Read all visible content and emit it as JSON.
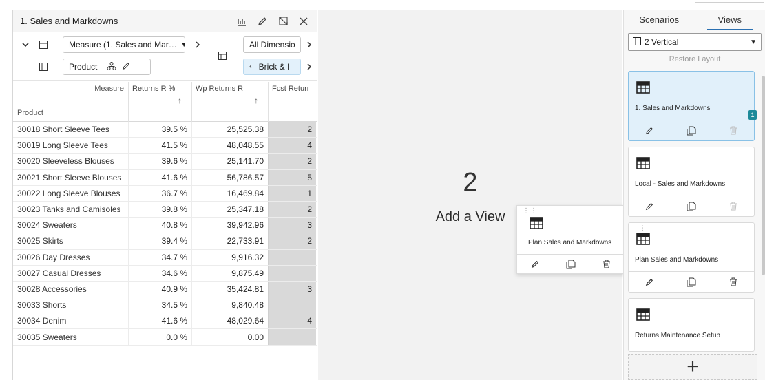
{
  "left_panel": {
    "title": "1. Sales and Markdowns",
    "measure_select": "Measure (1. Sales and Mar…",
    "dimension_select": "All Dimensio",
    "product_chip": "Product",
    "brick_chip": "Brick & I",
    "grid": {
      "measure_label": "Measure",
      "product_label": "Product",
      "columns": [
        "Returns R %",
        "Wp Returns R",
        "Fcst Returr"
      ],
      "sort_arrow": "↑",
      "rows": [
        {
          "product": "30018 Short Sleeve Tees",
          "returns_pct": "39.5 %",
          "wp_returns": "25,525.38",
          "fcst": "2"
        },
        {
          "product": "30019 Long Sleeve Tees",
          "returns_pct": "41.5 %",
          "wp_returns": "48,048.55",
          "fcst": "4"
        },
        {
          "product": "30020 Sleeveless Blouses",
          "returns_pct": "39.6 %",
          "wp_returns": "25,141.70",
          "fcst": "2"
        },
        {
          "product": "30021 Short Sleeve Blouses",
          "returns_pct": "41.6 %",
          "wp_returns": "56,786.57",
          "fcst": "5"
        },
        {
          "product": "30022 Long Sleeve Blouses",
          "returns_pct": "36.7 %",
          "wp_returns": "16,469.84",
          "fcst": "1"
        },
        {
          "product": "30023 Tanks and Camisoles",
          "returns_pct": "39.8 %",
          "wp_returns": "25,347.18",
          "fcst": "2"
        },
        {
          "product": "30024 Sweaters",
          "returns_pct": "40.8 %",
          "wp_returns": "39,942.96",
          "fcst": "3"
        },
        {
          "product": "30025 Skirts",
          "returns_pct": "39.4 %",
          "wp_returns": "22,733.91",
          "fcst": "2"
        },
        {
          "product": "30026 Day Dresses",
          "returns_pct": "34.7 %",
          "wp_returns": "9,916.32",
          "fcst": ""
        },
        {
          "product": "30027 Casual Dresses",
          "returns_pct": "34.6 %",
          "wp_returns": "9,875.49",
          "fcst": ""
        },
        {
          "product": "30028 Accessories",
          "returns_pct": "40.9 %",
          "wp_returns": "35,424.81",
          "fcst": "3"
        },
        {
          "product": "30033 Shorts",
          "returns_pct": "34.5 %",
          "wp_returns": "9,840.48",
          "fcst": ""
        },
        {
          "product": "30034 Denim",
          "returns_pct": "41.6 %",
          "wp_returns": "48,029.64",
          "fcst": "4"
        },
        {
          "product": "30035 Sweaters",
          "returns_pct": "0.0 %",
          "wp_returns": "0.00",
          "fcst": ""
        }
      ]
    }
  },
  "center": {
    "number": "2",
    "label": "Add a View"
  },
  "drag_card": {
    "title": "Plan Sales and Markdowns"
  },
  "right_panel": {
    "tabs": [
      "Scenarios",
      "Views"
    ],
    "active_tab": "Views",
    "layout_select": "2 Vertical",
    "restore_label": "Restore Layout",
    "cards": [
      {
        "title": "1. Sales and Markdowns",
        "badge": "1"
      },
      {
        "title": "Local - Sales and Markdowns"
      },
      {
        "title": "Plan Sales and Markdowns"
      },
      {
        "title": "Returns Maintenance Setup"
      }
    ],
    "add_label": "+"
  },
  "colors": {
    "selected_card_bg": "#e1f0fa",
    "accent": "#2a6fb1",
    "badge": "#1d8a99",
    "fcst_col_bg": "#d9d9d9"
  }
}
